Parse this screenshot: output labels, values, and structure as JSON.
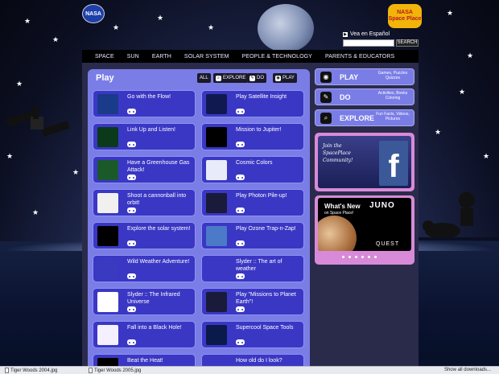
{
  "header": {
    "nasa_logo": "NASA",
    "spaceplace_logo": "NASA Space Place",
    "espanol_link": "Vea en Español",
    "search_placeholder": "",
    "search_button": "SEARCH"
  },
  "topnav": [
    "SPACE",
    "SUN",
    "EARTH",
    "SOLAR SYSTEM",
    "PEOPLE & TECHNOLOGY",
    "PARENTS & EDUCATORS"
  ],
  "play": {
    "title": "Play",
    "filters": {
      "all": "ALL",
      "explore": "EXPLORE",
      "do": "DO",
      "play": "PLAY"
    },
    "cards": [
      {
        "title": "Go with the Flow!",
        "thumb_color": "#1a3a8a"
      },
      {
        "title": "Play Satellite Insight",
        "thumb_color": "#101a50"
      },
      {
        "title": "Link Up and Listen!",
        "thumb_color": "#0a3a1a"
      },
      {
        "title": "Mission to Jupiter!",
        "thumb_color": "#000000"
      },
      {
        "title": "Have a Greenhouse Gas Attack!",
        "thumb_color": "#1a5a2a"
      },
      {
        "title": "Cosmic Colors",
        "thumb_color": "#e8ecf8"
      },
      {
        "title": "Shoot a cannonball into orbit!",
        "thumb_color": "#f0f0f0"
      },
      {
        "title": "Play Photon Pile-up!",
        "thumb_color": "#1a1a3a"
      },
      {
        "title": "Explore the solar system!",
        "thumb_color": "#000000"
      },
      {
        "title": "Play Ozone Trap-n-Zap!",
        "thumb_color": "#4a7ac8"
      },
      {
        "title": "Wild Weather Adventure!",
        "thumb_color": "#3a3ac0"
      },
      {
        "title": "Slyder :: The art of weather",
        "thumb_color": "#3a37c4"
      },
      {
        "title": "Slyder :: The Infrared Universe",
        "thumb_color": "#ffffff"
      },
      {
        "title": "Play \"Missions to Planet Earth\"!",
        "thumb_color": "#1a1a3a"
      },
      {
        "title": "Fall into a Black Hole!",
        "thumb_color": "#f4f0ff"
      },
      {
        "title": "Supercool Space Tools",
        "thumb_color": "#0a1a4a"
      },
      {
        "title": "Beat the Heat!",
        "thumb_color": "#000000"
      },
      {
        "title": "How old do I look?",
        "thumb_color": "#3a37c4"
      }
    ]
  },
  "sidebar": {
    "play": {
      "label": "PLAY",
      "sub": "Games, Puzzles Quizzes"
    },
    "do": {
      "label": "DO",
      "sub": "Activities, Books Coloring"
    },
    "explore": {
      "label": "EXPLORE",
      "sub": "Fun Facts, Videos, Pictures"
    },
    "facebook_text": "Join the SpacePlace Community!",
    "facebook_letter": "f",
    "whatsnew_title": "What's New",
    "whatsnew_sub": "on Space Place!",
    "whatsnew_juno": "JUNO",
    "whatsnew_quest": "QUEST"
  },
  "downloads": {
    "items": [
      "Tiger Woods 2004.jpg",
      "Tiger Woods 2005.jpg"
    ],
    "show_all": "Show all downloads..."
  }
}
